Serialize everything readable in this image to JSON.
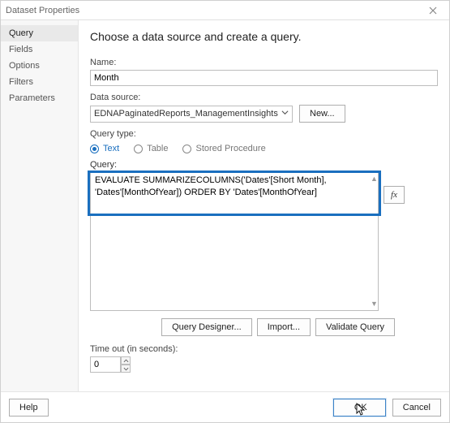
{
  "window": {
    "title": "Dataset Properties"
  },
  "sidebar": {
    "items": [
      {
        "label": "Query"
      },
      {
        "label": "Fields"
      },
      {
        "label": "Options"
      },
      {
        "label": "Filters"
      },
      {
        "label": "Parameters"
      }
    ]
  },
  "main": {
    "heading": "Choose a data source and create a query.",
    "name_label": "Name:",
    "name_value": "Month",
    "datasource_label": "Data source:",
    "datasource_value": "EDNAPaginatedReports_ManagementInsights",
    "new_btn": "New...",
    "querytype_label": "Query type:",
    "querytype_options": [
      "Text",
      "Table",
      "Stored Procedure"
    ],
    "query_label": "Query:",
    "query_text": "EVALUATE SUMMARIZECOLUMNS('Dates'[Short Month], 'Dates'[MonthOfYear]) ORDER BY 'Dates'[MonthOfYear]",
    "fx_label": "fx",
    "buttons": {
      "designer": "Query Designer...",
      "import": "Import...",
      "validate": "Validate Query"
    },
    "timeout_label": "Time out (in seconds):",
    "timeout_value": "0"
  },
  "footer": {
    "help": "Help",
    "ok": "OK",
    "cancel": "Cancel"
  }
}
